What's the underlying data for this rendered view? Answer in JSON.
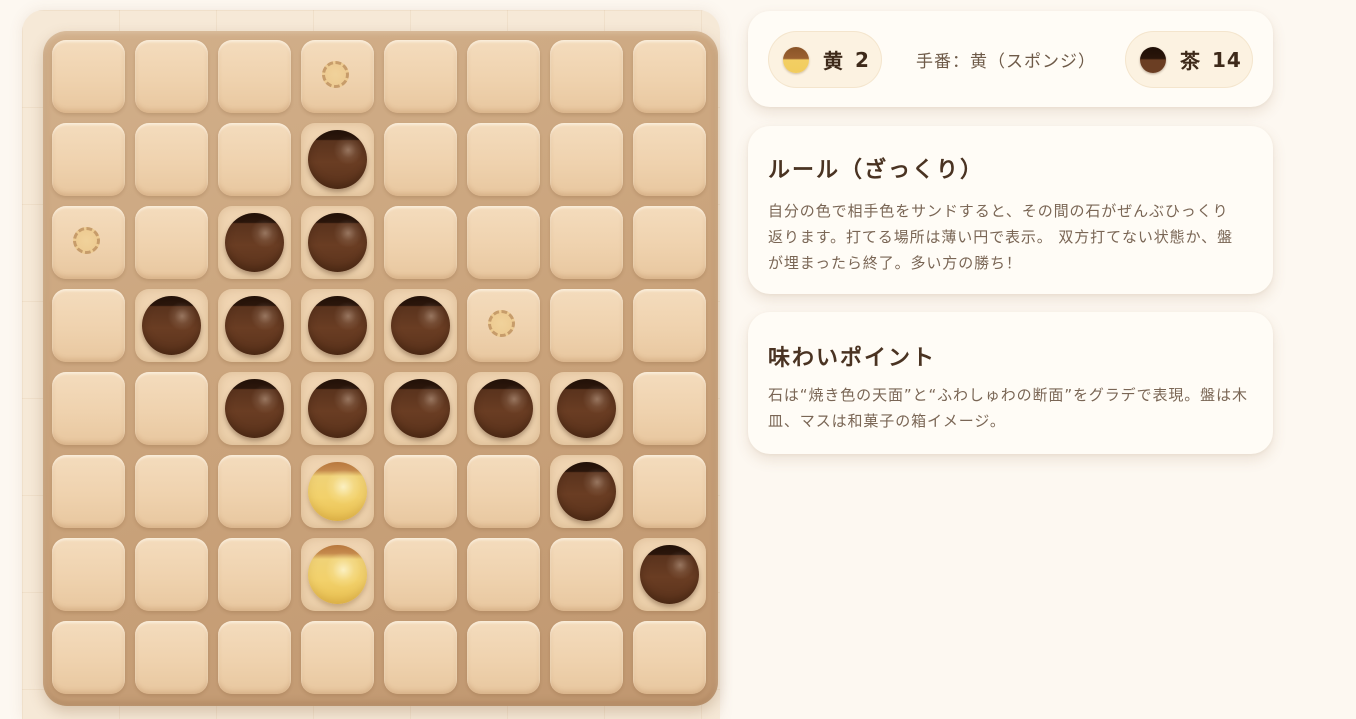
{
  "board": {
    "size": 8,
    "rows": [
      [
        ".",
        ".",
        ".",
        "h",
        ".",
        ".",
        ".",
        "."
      ],
      [
        ".",
        ".",
        ".",
        "B",
        ".",
        ".",
        ".",
        "."
      ],
      [
        "h",
        ".",
        "B",
        "B",
        ".",
        ".",
        ".",
        "."
      ],
      [
        ".",
        "B",
        "B",
        "B",
        "B",
        "h",
        ".",
        "."
      ],
      [
        ".",
        ".",
        "B",
        "B",
        "B",
        "B",
        "B",
        "."
      ],
      [
        ".",
        ".",
        ".",
        "Y",
        ".",
        ".",
        "B",
        "."
      ],
      [
        ".",
        ".",
        ".",
        "Y",
        ".",
        ".",
        ".",
        "B"
      ],
      [
        ".",
        ".",
        ".",
        ".",
        ".",
        ".",
        ".",
        "."
      ]
    ],
    "legend": {
      "Y": "yellow-piece",
      "B": "brown-piece",
      "h": "valid-move-hint",
      ".": "empty"
    }
  },
  "scoreboard": {
    "yellow": {
      "name": "黄",
      "count": "2",
      "icon": "yellow-chip-icon",
      "color": "#f1cc5d"
    },
    "brown": {
      "name": "茶",
      "count": "14",
      "icon": "brown-chip-icon",
      "color": "#6b3e23"
    },
    "turn": "手番：黄（スポンジ）"
  },
  "rules": {
    "title": "ルール（ざっくり）",
    "text": "自分の色で相手色をサンドすると、その間の石がぜんぶひっくり\n返ります。打てる場所は薄い円で表示。 双方打てない状態か、盤\nが埋まったら終了。多い方の勝ち！"
  },
  "points": {
    "title": "味わいポイント",
    "text": "石は“焼き色の天面”と“ふわしゅわの断面”をグラデで表現。盤は木\n皿、マスは和菓子の箱イメージ。"
  },
  "colors": {
    "background": "#fdf8f1",
    "tray": "#c9a27a",
    "cell": "#efd2ae",
    "yellow_piece": "#f2d16b",
    "brown_piece": "#6a3d23",
    "hint_ring": "#c59a67"
  }
}
